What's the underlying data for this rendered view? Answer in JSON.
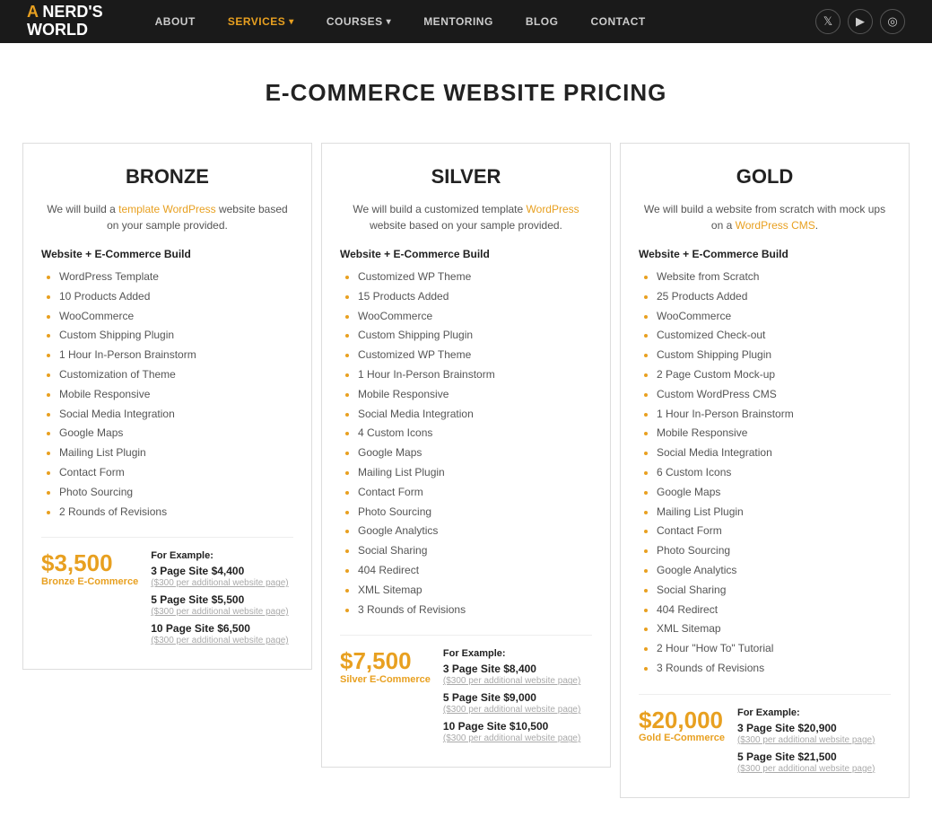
{
  "nav": {
    "logo_line1": "A NERD'S",
    "logo_line2": "WORLD",
    "links": [
      {
        "label": "ABOUT",
        "active": false
      },
      {
        "label": "SERVICES",
        "active": true,
        "hasArrow": true
      },
      {
        "label": "COURSES",
        "active": false,
        "hasArrow": true
      },
      {
        "label": "MENTORING",
        "active": false
      },
      {
        "label": "BLOG",
        "active": false
      },
      {
        "label": "CONTACT",
        "active": false
      }
    ],
    "icons": [
      "🐦",
      "▶",
      "📷"
    ]
  },
  "page": {
    "title": "E-COMMERCE WEBSITE PRICING"
  },
  "plans": [
    {
      "id": "bronze",
      "title": "BRONZE",
      "description_parts": [
        {
          "text": "We will build a "
        },
        {
          "text": "template WordPress",
          "link": true
        },
        {
          "text": " website based on your sample provided."
        }
      ],
      "section_header": "Website +  E-Commerce Build",
      "features": [
        "WordPress Template",
        "10 Products Added",
        "WooCommerce",
        "Custom Shipping Plugin",
        "1 Hour In-Person Brainstorm",
        "Customization of Theme",
        "Mobile Responsive",
        "Social Media Integration",
        "Google Maps",
        "Mailing List Plugin",
        "Contact Form",
        "Photo Sourcing",
        "2 Rounds of Revisions"
      ],
      "price": "$3,500",
      "price_label": "Bronze E-Commerce",
      "example_label": "For Example:",
      "examples": [
        {
          "item": "3 Page Site $4,400",
          "note": "($300 per additional website page)"
        },
        {
          "item": "5 Page Site $5,500",
          "note": "($300 per additional website page)"
        },
        {
          "item": "10 Page Site $6,500",
          "note": "($300 per additional website page)"
        }
      ]
    },
    {
      "id": "silver",
      "title": "SILVER",
      "description_parts": [
        {
          "text": "We will build a customized template "
        },
        {
          "text": "WordPress",
          "link": true
        },
        {
          "text": " website based on your sample provided."
        }
      ],
      "section_header": "Website + E-Commerce Build",
      "features": [
        "Customized WP Theme",
        "15 Products Added",
        "WooCommerce",
        "Custom Shipping Plugin",
        "Customized WP Theme",
        "1 Hour In-Person Brainstorm",
        "Mobile Responsive",
        "Social Media Integration",
        "4 Custom Icons",
        "Google Maps",
        "Mailing List Plugin",
        "Contact Form",
        "Photo Sourcing",
        "Google Analytics",
        "Social Sharing",
        "404 Redirect",
        "XML Sitemap",
        "3 Rounds of Revisions"
      ],
      "price": "$7,500",
      "price_label": "Silver E-Commerce",
      "example_label": "For Example:",
      "examples": [
        {
          "item": "3 Page Site $8,400",
          "note": "($300 per additional website page)"
        },
        {
          "item": "5 Page Site $9,000",
          "note": "($300 per additional website page)"
        },
        {
          "item": "10 Page Site $10,500",
          "note": "($300 per additional website page)"
        }
      ]
    },
    {
      "id": "gold",
      "title": "GOLD",
      "description_parts": [
        {
          "text": "We will build a website from scratch with mock ups on a "
        },
        {
          "text": "WordPress CMS",
          "link": true
        },
        {
          "text": "."
        }
      ],
      "section_header": "Website + E-Commerce Build",
      "features": [
        "Website from Scratch",
        "25 Products Added",
        "WooCommerce",
        "Customized Check-out",
        "Custom Shipping Plugin",
        "2 Page Custom Mock-up",
        "Custom WordPress CMS",
        "1 Hour In-Person Brainstorm",
        "Mobile Responsive",
        "Social Media Integration",
        "6 Custom Icons",
        "Google Maps",
        "Mailing List Plugin",
        "Contact Form",
        "Photo Sourcing",
        "Google Analytics",
        "Social Sharing",
        "404 Redirect",
        "XML Sitemap",
        "2 Hour \"How To\" Tutorial",
        "3 Rounds of Revisions"
      ],
      "price": "$20,000",
      "price_label": "Gold E-Commerce",
      "example_label": "For Example:",
      "examples": [
        {
          "item": "3 Page Site $20,900",
          "note": "($300 per additional website page)"
        },
        {
          "item": "5 Page Site $21,500",
          "note": "($300 per additional website page)"
        }
      ]
    }
  ]
}
